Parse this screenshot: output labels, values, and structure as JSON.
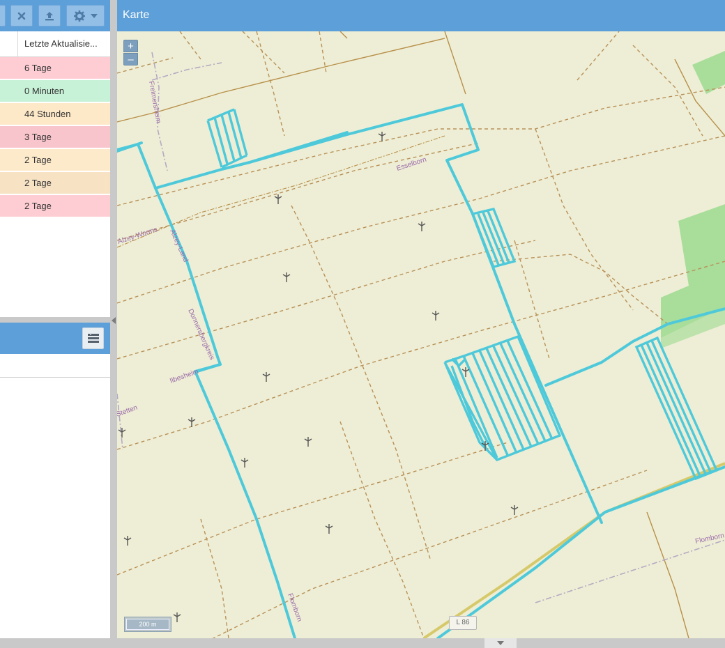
{
  "left_panel": {
    "column_header": "Letzte Aktualisie...",
    "rows": [
      {
        "value": "6 Tage",
        "color": "#fdcdd3"
      },
      {
        "value": "0 Minuten",
        "color": "#c8f2d8"
      },
      {
        "value": "44 Stunden",
        "color": "#fde8c8"
      },
      {
        "value": "3 Tage",
        "color": "#f9c5cc"
      },
      {
        "value": "2 Tage",
        "color": "#fdeacb"
      },
      {
        "value": "2 Tage",
        "color": "#f7e2c4"
      },
      {
        "value": "2 Tage",
        "color": "#fdcdd3"
      }
    ]
  },
  "map": {
    "title": "Karte",
    "zoom_in": "+",
    "zoom_out": "–",
    "scale": "200 m",
    "road_shield": "L 86",
    "labels": {
      "freimersheim": "Freimersheim",
      "esselborn": "Esselborn",
      "alzey_worms": "Alzey-Worms",
      "alzey_land": "Alzey-Land",
      "donnersbergkreis": "Donnersbergkreis",
      "ilbesheim": "Ilbesheim",
      "stetten": "Stetten",
      "flomborn_left": "Flomborn",
      "flomborn_right": "Flomborn"
    },
    "colors": {
      "land": "#eeeed6",
      "track": "#4ec9da",
      "forest": "#a9dd9a",
      "boundary": "#b8904a"
    }
  },
  "icons": {
    "toolbar": [
      "close-icon",
      "upload-icon",
      "gear-icon",
      "caret-down-icon"
    ],
    "panel_menu": "list-icon",
    "turbine": "wind-turbine-icon"
  }
}
